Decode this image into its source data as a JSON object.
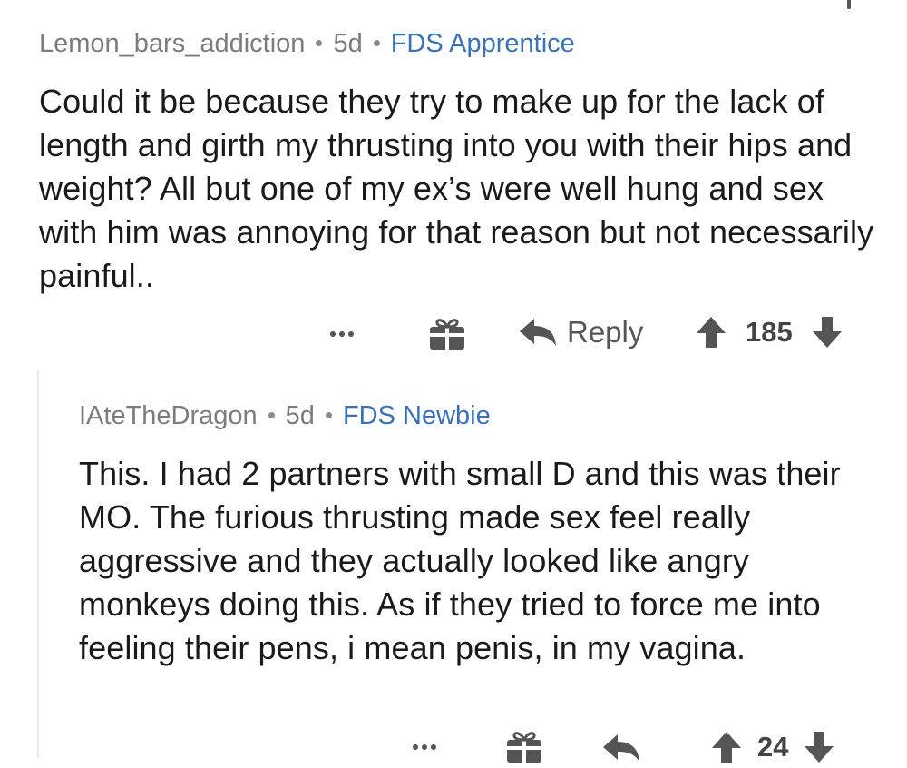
{
  "comments": [
    {
      "username": "Lemon_bars_addiction",
      "age": "5d",
      "flair": "FDS Apprentice",
      "body": "Could it be because they try to make up for the lack of length and girth my thrusting into you with their hips and weight? All but one of my ex’s were well hung and sex with him was annoying for that reason but not necessarily painful..",
      "actions": {
        "more_icon": "ellipsis-icon",
        "award_icon": "gift-icon",
        "reply_icon": "reply-arrow-icon",
        "reply_label": "Reply",
        "upvote_icon": "upvote-arrow-icon",
        "score": "185",
        "downvote_icon": "downvote-arrow-icon"
      }
    },
    {
      "username": "IAteTheDragon",
      "age": "5d",
      "flair": "FDS Newbie",
      "body": "This. I had 2 partners with small D and this was their MO. The furious thrusting made sex feel really aggressive and they actually looked like angry monkeys doing this. As if they tried to force me into feeling their pens, i mean penis, in my vagina.",
      "actions": {
        "more_icon": "ellipsis-icon",
        "award_icon": "gift-icon",
        "reply_icon": "reply-arrow-icon",
        "upvote_icon": "upvote-arrow-icon",
        "score": "24",
        "downvote_icon": "downvote-arrow-icon"
      }
    }
  ],
  "colors": {
    "meta_text": "#7c7c7c",
    "flair_text": "#3a72b8",
    "body_text": "#1a1a1a",
    "icon": "#555555",
    "thread_line": "#e8e8e8"
  }
}
